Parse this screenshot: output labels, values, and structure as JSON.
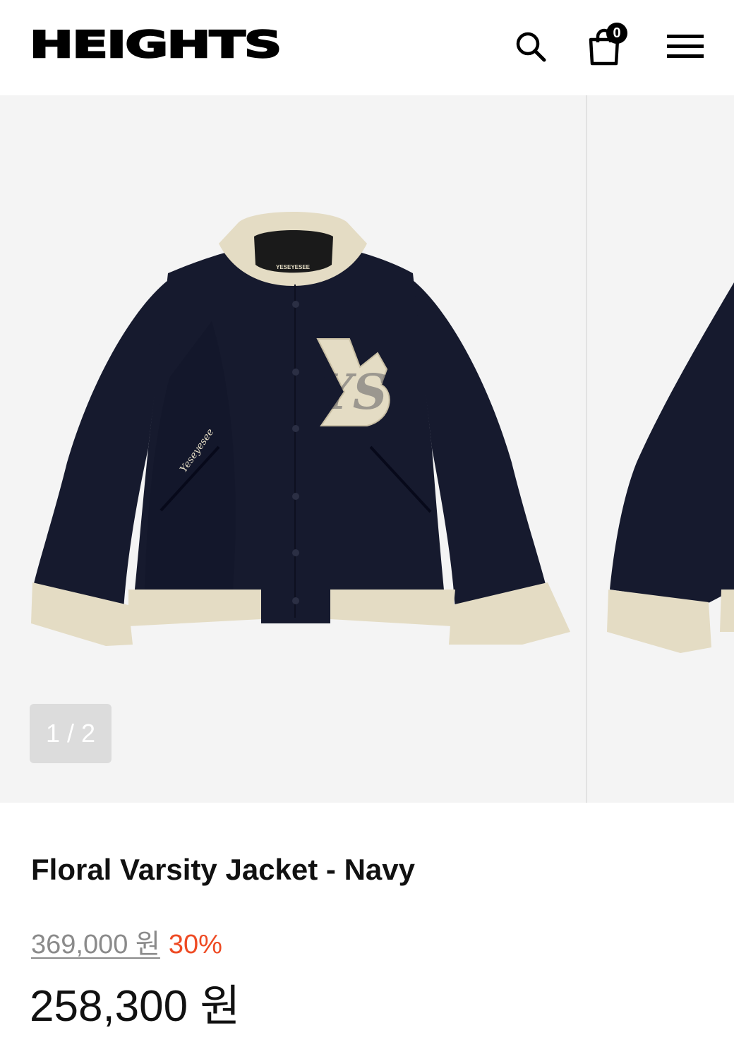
{
  "header": {
    "logo": "HEIGHTS",
    "cart_count": "0",
    "icons": [
      "search-icon",
      "shopping-bag-icon",
      "hamburger-menu-icon"
    ]
  },
  "gallery": {
    "counter": "1 / 2",
    "patch_text": "YS",
    "collar_label": "YESEYESEE",
    "pocket_script": "Yeseyesee"
  },
  "product": {
    "title": "Floral Varsity Jacket - Navy",
    "original_price": "369,000 원",
    "discount": "30%",
    "sale_price": "258,300 원"
  },
  "colors": {
    "discount": "#ee4a23",
    "jacket_navy": "#161a2e",
    "rib_beige": "#e4dcc4"
  }
}
